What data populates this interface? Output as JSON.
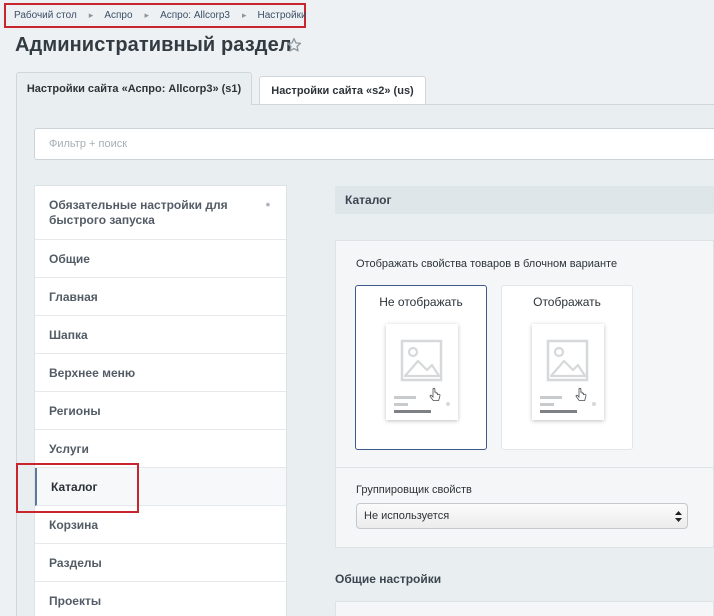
{
  "breadcrumb": {
    "items": [
      "Рабочий стол",
      "Аспро",
      "Аспро: Allcorp3",
      "Настройки"
    ]
  },
  "page_title": "Административный раздел",
  "tabs": [
    {
      "label": "Настройки сайта «Аспро: Allcorp3» (s1)",
      "active": true
    },
    {
      "label": "Настройки сайта «s2» (us)",
      "active": false
    }
  ],
  "filter": {
    "placeholder": "Фильтр + поиск"
  },
  "menu": {
    "items": [
      {
        "label": "Обязательные настройки для быстрого запуска",
        "marker": "*"
      },
      {
        "label": "Общие"
      },
      {
        "label": "Главная"
      },
      {
        "label": "Шапка"
      },
      {
        "label": "Верхнее меню"
      },
      {
        "label": "Регионы"
      },
      {
        "label": "Услуги"
      },
      {
        "label": "Каталог",
        "active": true
      },
      {
        "label": "Корзина"
      },
      {
        "label": "Разделы"
      },
      {
        "label": "Проекты"
      }
    ]
  },
  "catalog": {
    "header": "Каталог",
    "display_label": "Отображать свойства товаров в блочном варианте",
    "options": [
      {
        "label": "Не отображать",
        "selected": true
      },
      {
        "label": "Отображать",
        "selected": false
      }
    ],
    "grouper_label": "Группировщик свойств",
    "grouper_value": "Не используется"
  },
  "general": {
    "title": "Общие настройки"
  },
  "colors": {
    "highlight": "#c8262e",
    "selected_border": "#3e5a8a"
  }
}
